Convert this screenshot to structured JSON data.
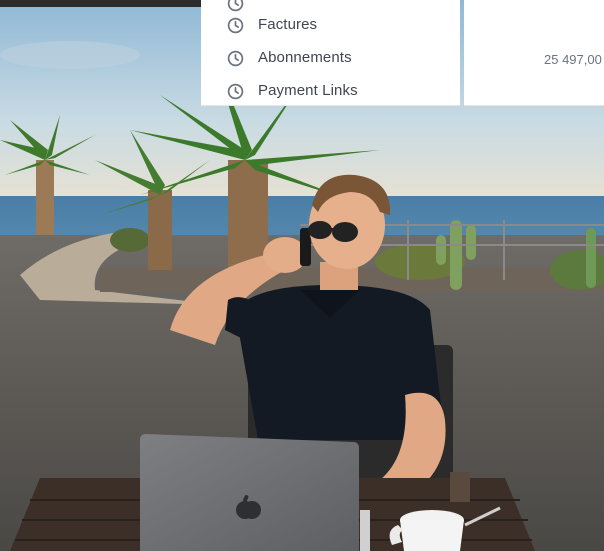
{
  "menu": {
    "items": [
      {
        "label": "Factures",
        "icon": "clock-icon"
      },
      {
        "label": "Abonnements",
        "icon": "clock-icon"
      },
      {
        "label": "Payment Links",
        "icon": "clock-icon"
      }
    ]
  },
  "summary": {
    "value": "25 497,00"
  },
  "colors": {
    "menu_text": "#414552",
    "icon": "#6b7280",
    "value_text": "#6b7280"
  }
}
